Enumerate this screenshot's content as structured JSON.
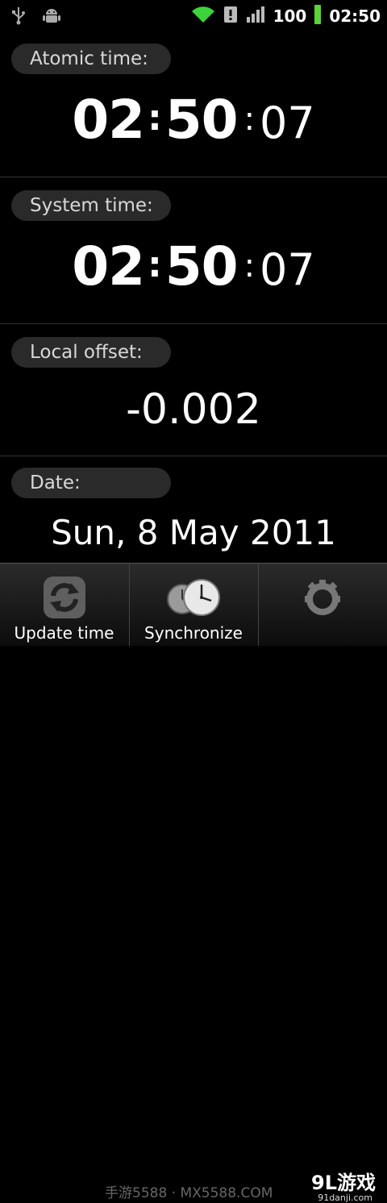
{
  "status_bar": {
    "battery": "100",
    "clock": "02:50",
    "icons": [
      "usb-icon",
      "android-debug-icon",
      "wifi-icon",
      "alert-icon",
      "signal-icon",
      "battery-icon"
    ]
  },
  "atomic": {
    "label": "Atomic time:",
    "hours": "02",
    "sep1": ":",
    "minutes": "50",
    "sep2": ":",
    "seconds": "07"
  },
  "system": {
    "label": "System time:",
    "hours": "02",
    "sep1": ":",
    "minutes": "50",
    "sep2": ":",
    "seconds": "07"
  },
  "offset": {
    "label": "Local offset:",
    "value": "-0.002"
  },
  "date": {
    "label": "Date:",
    "value": "Sun, 8 May 2011"
  },
  "toolbar": {
    "update_label": "Update time",
    "sync_label": "Synchronize",
    "settings_label": ""
  },
  "watermark": {
    "text": "手游5588 · MX5588.COM",
    "logo": "9L游戏",
    "logo_sub": "91danji.com"
  },
  "colors": {
    "background": "#000000",
    "pill": "#2a2a2a",
    "wifi": "#3cd33c",
    "battery": "#5bd23a"
  }
}
